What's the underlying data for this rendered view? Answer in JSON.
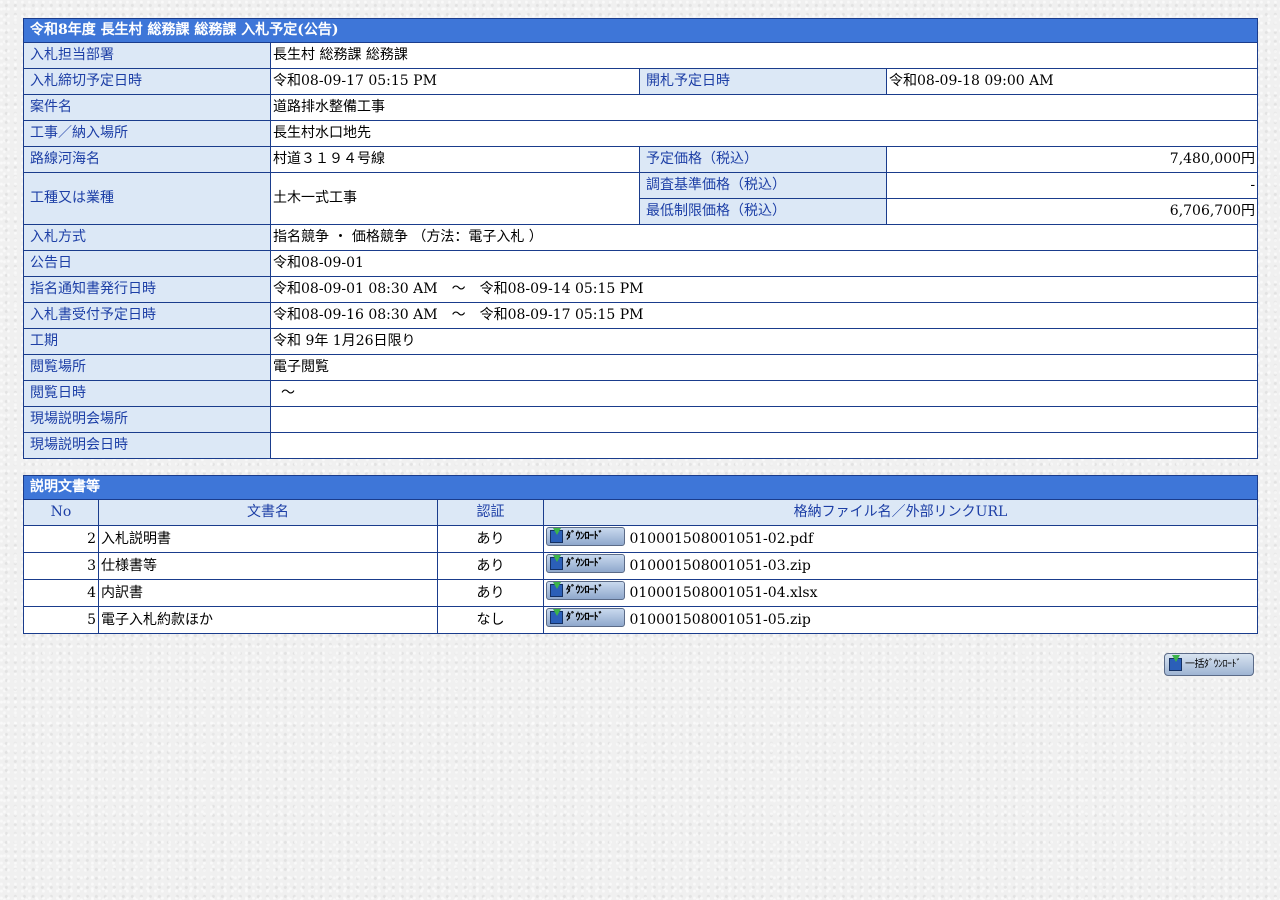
{
  "notice": {
    "title": "令和8年度 長生村 総務課 総務課 入札予定(公告)",
    "rows": {
      "dept": {
        "label": "入札担当部署",
        "value": "長生村 総務課 総務課"
      },
      "deadline": {
        "label": "入札締切予定日時",
        "value": "令和08-09-17 05:15 PM",
        "label2": "開札予定日時",
        "value2": "令和08-09-18 09:00 AM"
      },
      "case_name": {
        "label": "案件名",
        "value": "道路排水整備工事"
      },
      "location": {
        "label": "工事／納入場所",
        "value": "長生村水口地先"
      },
      "route": {
        "label": "路線河海名",
        "value": "村道３１９４号線",
        "label2": "予定価格（税込）",
        "value2": "7,480,000円"
      },
      "work_type": {
        "label": "工種又は業種",
        "value": "土木一式工事"
      },
      "survey_price": {
        "label": "調査基準価格（税込）",
        "value": "-"
      },
      "min_price": {
        "label": "最低制限価格（税込）",
        "value": "6,706,700円"
      },
      "method": {
        "label": "入札方式",
        "value": "指名競争 ・ 価格競争 （方法：電子入札 ）"
      },
      "announce_date": {
        "label": "公告日",
        "value": "令和08-09-01"
      },
      "notice_issue": {
        "label": "指名通知書発行日時",
        "value": "令和08-09-01 08:30 AM　～　令和08-09-14 05:15 PM"
      },
      "bid_accept": {
        "label": "入札書受付予定日時",
        "value": "令和08-09-16 08:30 AM　～　令和08-09-17 05:15 PM"
      },
      "period": {
        "label": "工期",
        "value": "令和 9年 1月26日限り"
      },
      "view_place": {
        "label": "閲覧場所",
        "value": "電子閲覧"
      },
      "view_date": {
        "label": "閲覧日時",
        "value": "～"
      },
      "briefing_place": {
        "label": "現場説明会場所",
        "value": ""
      },
      "briefing_date": {
        "label": "現場説明会日時",
        "value": ""
      }
    }
  },
  "documents": {
    "title": "説明文書等",
    "headers": {
      "no": "No",
      "name": "文書名",
      "auth": "認証",
      "file": "格納ファイル名／外部リンクURL"
    },
    "download_label": "ﾀﾞｳﾝﾛｰﾄﾞ",
    "rows": [
      {
        "no": "2",
        "name": "入札説明書",
        "auth": "あり",
        "file": "010001508001051-02.pdf"
      },
      {
        "no": "3",
        "name": "仕様書等",
        "auth": "あり",
        "file": "010001508001051-03.zip"
      },
      {
        "no": "4",
        "name": "内訳書",
        "auth": "あり",
        "file": "010001508001051-04.xlsx"
      },
      {
        "no": "5",
        "name": "電子入札約款ほか",
        "auth": "なし",
        "file": "010001508001051-05.zip"
      }
    ]
  },
  "bulk_download": {
    "label": "一括ﾀﾞｳﾝﾛｰﾄﾞ"
  },
  "icons": {
    "download": "floppy-download-icon"
  },
  "colors": {
    "header_bg": "#3e76d8",
    "label_bg": "#dce8f6",
    "label_text": "#1d3fa6",
    "border": "#1a3c8c"
  }
}
